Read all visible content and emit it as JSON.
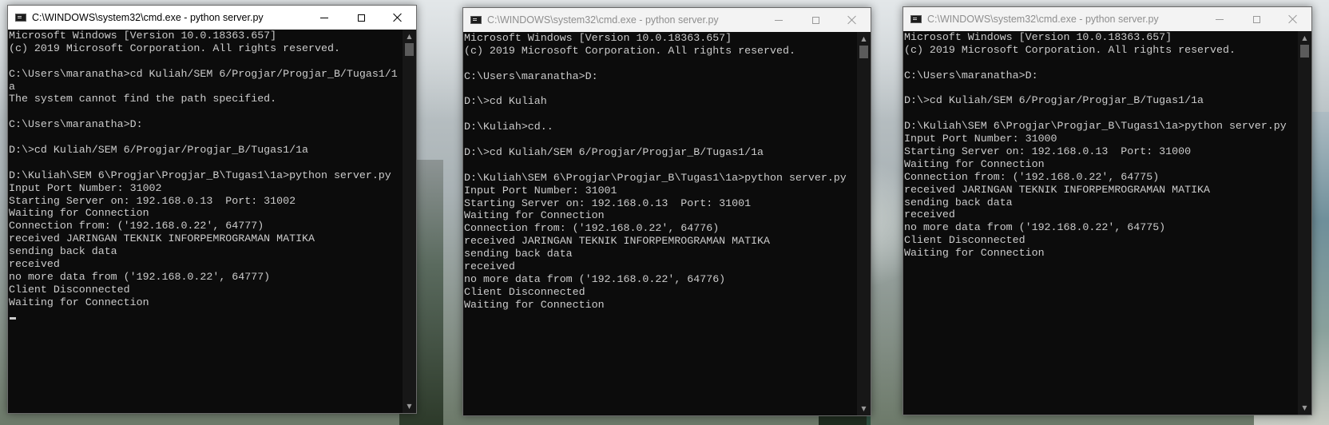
{
  "windows": [
    {
      "title": "C:\\WINDOWS\\system32\\cmd.exe - python  server.py",
      "lines": [
        "Microsoft Windows [Version 10.0.18363.657]",
        "(c) 2019 Microsoft Corporation. All rights reserved.",
        "",
        "C:\\Users\\maranatha>cd Kuliah/SEM 6/Progjar/Progjar_B/Tugas1/1",
        "a",
        "The system cannot find the path specified.",
        "",
        "C:\\Users\\maranatha>D:",
        "",
        "D:\\>cd Kuliah/SEM 6/Progjar/Progjar_B/Tugas1/1a",
        "",
        "D:\\Kuliah\\SEM 6\\Progjar\\Progjar_B\\Tugas1\\1a>python server.py",
        "Input Port Number: 31002",
        "Starting Server on: 192.168.0.13  Port: 31002",
        "Waiting for Connection",
        "Connection from: ('192.168.0.22', 64777)",
        "received JARINGAN TEKNIK INFORPEMROGRAMAN MATIKA",
        "sending back data",
        "received",
        "no more data from ('192.168.0.22', 64777)",
        "Client Disconnected",
        "Waiting for Connection"
      ]
    },
    {
      "title": "C:\\WINDOWS\\system32\\cmd.exe - python  server.py",
      "lines": [
        "Microsoft Windows [Version 10.0.18363.657]",
        "(c) 2019 Microsoft Corporation. All rights reserved.",
        "",
        "C:\\Users\\maranatha>D:",
        "",
        "D:\\>cd Kuliah",
        "",
        "D:\\Kuliah>cd..",
        "",
        "D:\\>cd Kuliah/SEM 6/Progjar/Progjar_B/Tugas1/1a",
        "",
        "D:\\Kuliah\\SEM 6\\Progjar\\Progjar_B\\Tugas1\\1a>python server.py",
        "Input Port Number: 31001",
        "Starting Server on: 192.168.0.13  Port: 31001",
        "Waiting for Connection",
        "Connection from: ('192.168.0.22', 64776)",
        "received JARINGAN TEKNIK INFORPEMROGRAMAN MATIKA",
        "sending back data",
        "received",
        "no more data from ('192.168.0.22', 64776)",
        "Client Disconnected",
        "Waiting for Connection"
      ]
    },
    {
      "title": "C:\\WINDOWS\\system32\\cmd.exe - python  server.py",
      "lines": [
        "Microsoft Windows [Version 10.0.18363.657]",
        "(c) 2019 Microsoft Corporation. All rights reserved.",
        "",
        "C:\\Users\\maranatha>D:",
        "",
        "D:\\>cd Kuliah/SEM 6/Progjar/Progjar_B/Tugas1/1a",
        "",
        "D:\\Kuliah\\SEM 6\\Progjar\\Progjar_B\\Tugas1\\1a>python server.py",
        "Input Port Number: 31000",
        "Starting Server on: 192.168.0.13  Port: 31000",
        "Waiting for Connection",
        "Connection from: ('192.168.0.22', 64775)",
        "received JARINGAN TEKNIK INFORPEMROGRAMAN MATIKA",
        "sending back data",
        "received",
        "no more data from ('192.168.0.22', 64775)",
        "Client Disconnected",
        "Waiting for Connection"
      ]
    }
  ]
}
